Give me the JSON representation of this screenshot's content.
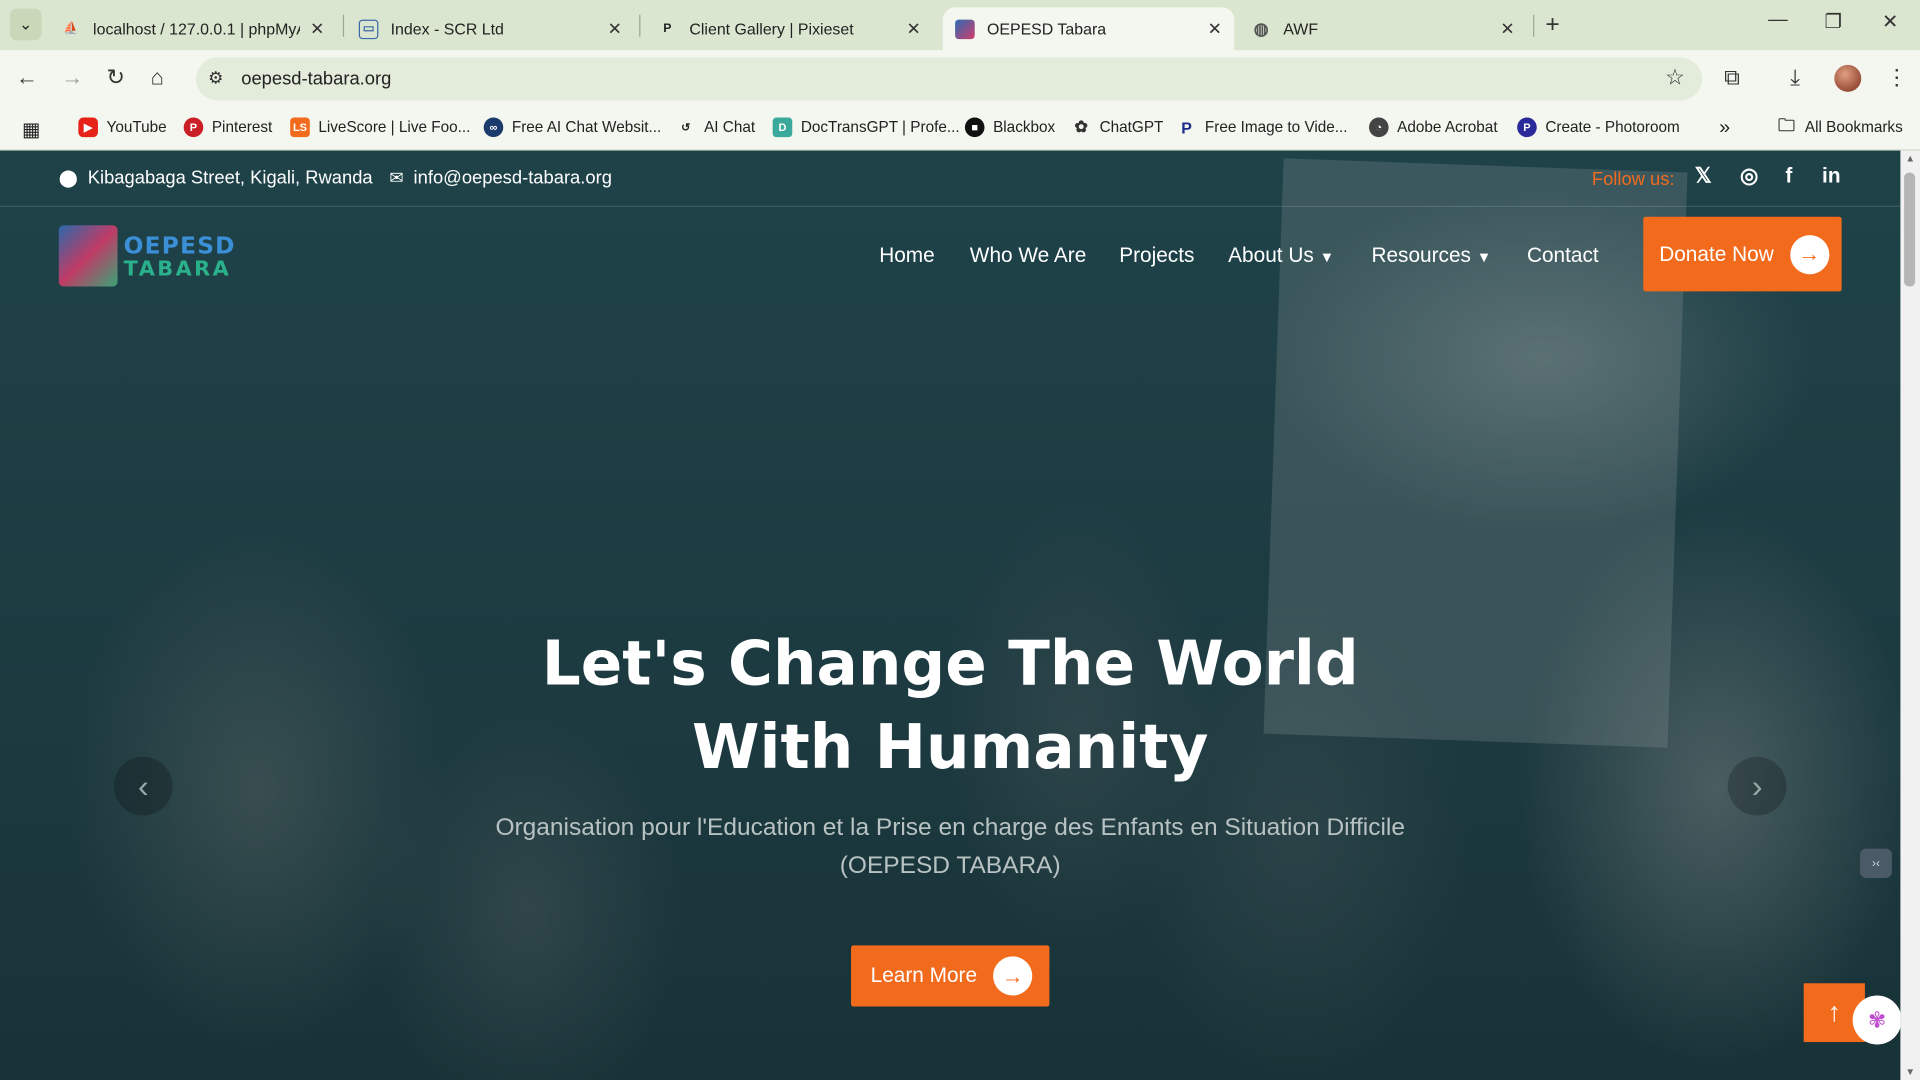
{
  "browser": {
    "tabs": [
      {
        "title": "localhost / 127.0.0.1 | phpMyAd",
        "icon": "phpmyadmin-icon"
      },
      {
        "title": "Index - SCR Ltd",
        "icon": "page-icon"
      },
      {
        "title": "Client Gallery | Pixieset",
        "icon": "pixieset-icon"
      },
      {
        "title": "OEPESD Tabara",
        "icon": "oepesd-icon"
      },
      {
        "title": "AWF",
        "icon": "globe-icon"
      }
    ],
    "url": "oepesd-tabara.org",
    "bookmarks": [
      {
        "label": "YouTube",
        "color": "#e62117"
      },
      {
        "label": "Pinterest",
        "color": "#cb1f27"
      },
      {
        "label": "LiveScore | Live Foo...",
        "color": "#f26b1d"
      },
      {
        "label": "Free AI Chat Websit...",
        "color": "#1a3b6b"
      },
      {
        "label": "AI Chat",
        "color": "#222222"
      },
      {
        "label": "DocTransGPT | Profe...",
        "color": "#3aa89a"
      },
      {
        "label": "Blackbox",
        "color": "#111111"
      },
      {
        "label": "ChatGPT",
        "color": "#333333"
      },
      {
        "label": "Free Image to Vide...",
        "color": "#1a2b8b"
      },
      {
        "label": "Adobe Acrobat",
        "color": "#444444"
      },
      {
        "label": "Create - Photoroom",
        "color": "#2a2a9a"
      }
    ],
    "all_bookmarks": "All Bookmarks"
  },
  "site": {
    "address": "Kibagabaga Street, Kigali, Rwanda",
    "email": "info@oepesd-tabara.org",
    "follow_label": "Follow us:",
    "logo": {
      "line1": "OEPESD",
      "line2": "TABARA"
    },
    "nav": [
      "Home",
      "Who We Are",
      "Projects",
      "About Us",
      "Resources",
      "Contact"
    ],
    "donate_label": "Donate Now",
    "hero": {
      "title_line1": "Let's Change The World",
      "title_line2": "With Humanity",
      "subtitle_line1": "Organisation pour l'Education et la Prise en charge des Enfants en Situation Difficile",
      "subtitle_line2": "(OEPESD TABARA)",
      "cta_label": "Learn More"
    },
    "colors": {
      "accent": "#f26b1d",
      "overlay": "#1b3a40"
    }
  }
}
